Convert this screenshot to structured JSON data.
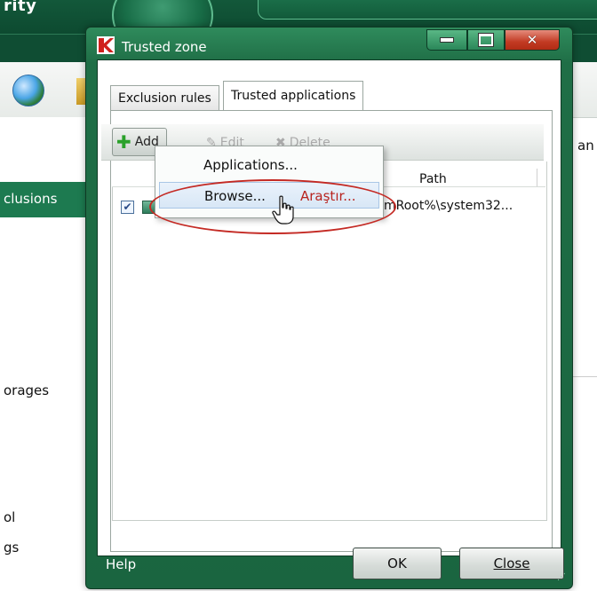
{
  "background": {
    "brand_partial": "rity",
    "sidebar": [
      "clusions",
      "orages",
      "ol",
      "gs"
    ],
    "right_partial": "an"
  },
  "dialog": {
    "title": "Trusted zone",
    "tabs": [
      "Exclusion rules",
      "Trusted applications"
    ],
    "active_tab": "Trusted applications",
    "toolbar": {
      "add": "Add",
      "edit": "Edit",
      "delete": "Delete"
    },
    "columns": {
      "path": "Path"
    },
    "row": {
      "checked": true,
      "path": "mRoot%\\system32..."
    },
    "menu": {
      "items": [
        "Applications...",
        "Browse..."
      ],
      "hovered": "Browse...",
      "annotation": "Araştır..."
    },
    "footer": {
      "help": "Help",
      "ok": "OK",
      "close": "Close"
    }
  },
  "colors": {
    "accent": "#1d7a50",
    "annotation": "#c42a24"
  }
}
